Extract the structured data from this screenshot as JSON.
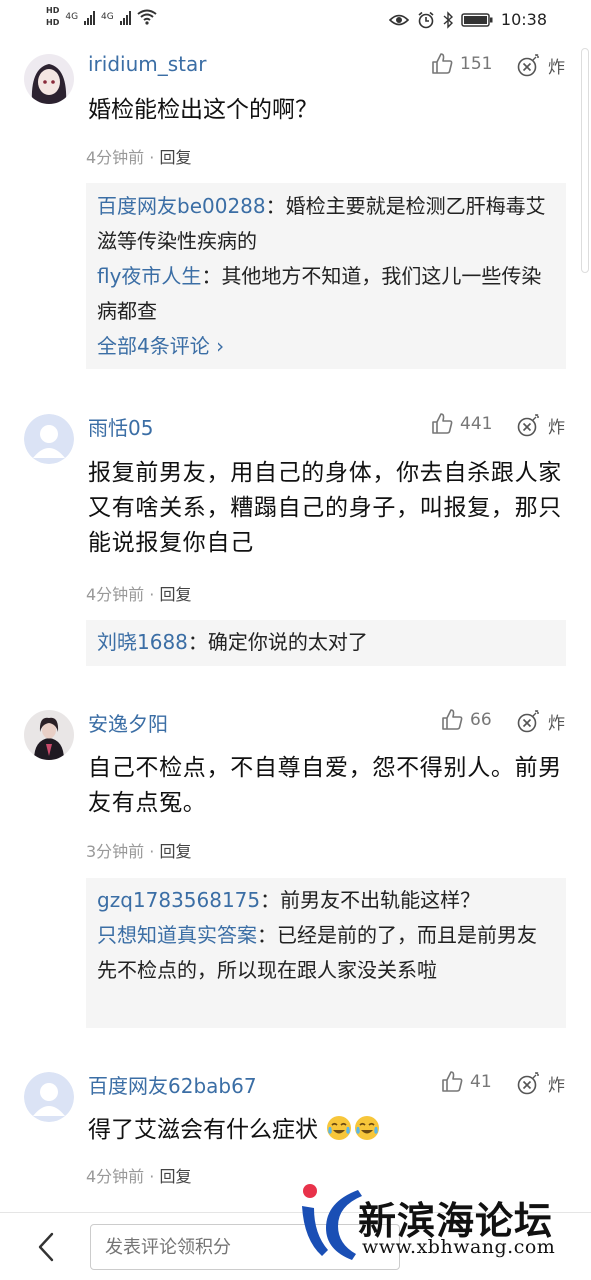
{
  "status_bar": {
    "hd1": "HD",
    "hd2": "HD",
    "net1": "4G",
    "net2": "4G",
    "time": "10:38"
  },
  "comments": [
    {
      "username": "iridium_star",
      "likes": "151",
      "boom_label": "炸",
      "text": "婚检能检出这个的啊？",
      "time": "4分钟前",
      "reply_label": "回复",
      "replies": [
        {
          "name": "百度网友be00288",
          "sep": "：",
          "text": "婚检主要就是检测乙肝梅毒艾滋等传染性疾病的"
        },
        {
          "name": "fly夜市人生",
          "sep": "：",
          "text": "其他地方不知道，我们这儿一些传染病都查"
        }
      ],
      "more": "全部4条评论"
    },
    {
      "username": "雨恬05",
      "likes": "441",
      "boom_label": "炸",
      "text": "报复前男友，用自己的身体，你去自杀跟人家又有啥关系，糟蹋自己的身子，叫报复，那只能说报复你自己",
      "time": "4分钟前",
      "reply_label": "回复",
      "replies": [
        {
          "name": "刘晓1688",
          "sep": "：",
          "text": "确定你说的太对了"
        }
      ]
    },
    {
      "username": "安逸夕阳",
      "likes": "66",
      "boom_label": "炸",
      "text": "自己不检点，不自尊自爱，怨不得别人。前男友有点冤。",
      "time": "3分钟前",
      "reply_label": "回复",
      "replies": [
        {
          "name": "gzq1783568175",
          "sep": "：",
          "text": "前男友不出轨能这样？"
        },
        {
          "name": "只想知道真实答案",
          "sep": "：",
          "text": "已经是前的了，而且是前男友先不检点的，所以现在跟人家没关系啦"
        }
      ]
    },
    {
      "username": "百度网友62bab67",
      "likes": "41",
      "boom_label": "炸",
      "text": "得了艾滋会有什么症状",
      "time": "4分钟前",
      "reply_label": "回复"
    }
  ],
  "bottom_bar": {
    "input_placeholder": "发表评论领积分"
  },
  "watermark": {
    "title": "新滨海论坛",
    "url": "www.xbhwang.com"
  },
  "icons": {
    "like": "thumbs-up-icon",
    "boom": "bomb-icon",
    "back": "back-arrow-icon",
    "emoji": "crying-laughing-emoji-icon"
  },
  "colors": {
    "username": "#3b6ea5",
    "reply_bg": "#f5f5f5",
    "meta": "#999999"
  }
}
